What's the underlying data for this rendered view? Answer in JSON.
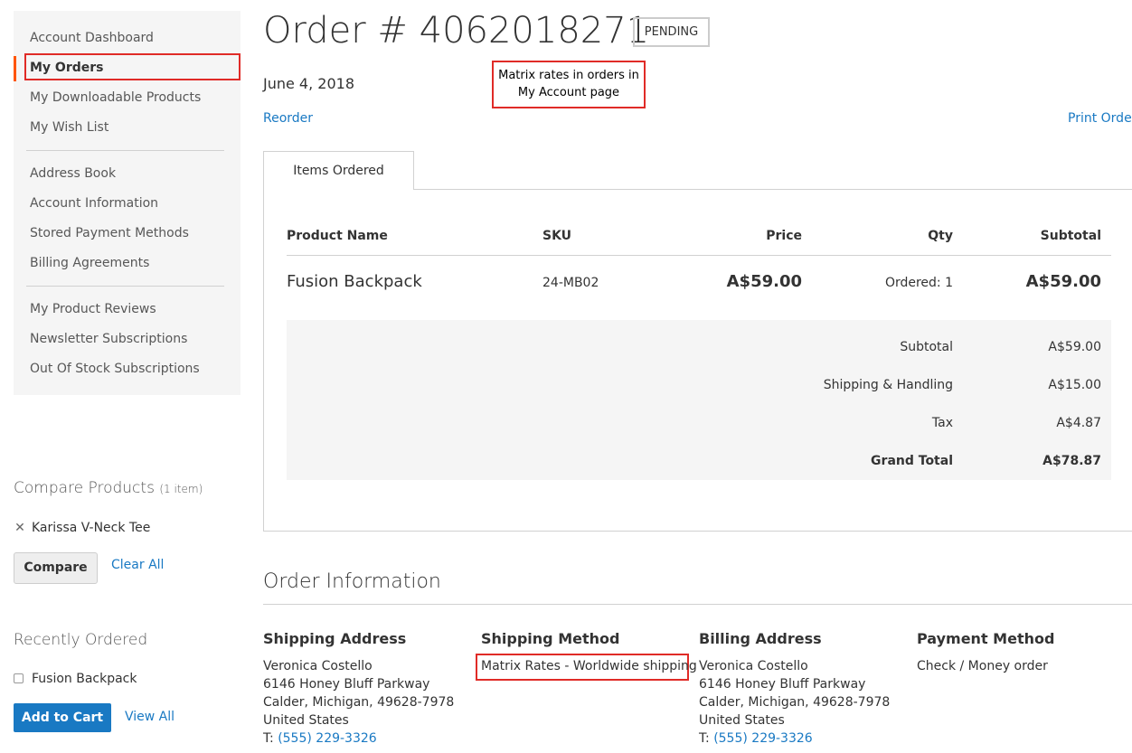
{
  "sidebar": {
    "nav": [
      {
        "label": "Account Dashboard"
      },
      {
        "label": "My Orders"
      },
      {
        "label": "My Downloadable Products"
      },
      {
        "label": "My Wish List"
      },
      {
        "label": "Address Book"
      },
      {
        "label": "Account Information"
      },
      {
        "label": "Stored Payment Methods"
      },
      {
        "label": "Billing Agreements"
      },
      {
        "label": "My Product Reviews"
      },
      {
        "label": "Newsletter Subscriptions"
      },
      {
        "label": "Out Of Stock Subscriptions"
      }
    ],
    "active_index": 1,
    "compare": {
      "title": "Compare Products",
      "count": "(1 item)",
      "item": "Karissa V-Neck Tee",
      "compare_label": "Compare",
      "clear_label": "Clear All"
    },
    "recent": {
      "title": "Recently Ordered",
      "item": "Fusion Backpack",
      "add_label": "Add to Cart",
      "view_all_label": "View All"
    }
  },
  "order": {
    "title": "Order # 4062018271",
    "status": "PENDING",
    "date": "June 4, 2018",
    "reorder_label": "Reorder",
    "print_label": "Print Order",
    "callout": "Matrix rates in orders in My Account page"
  },
  "tabs": [
    {
      "label": "Items Ordered"
    }
  ],
  "items_table": {
    "headers": {
      "name": "Product Name",
      "sku": "SKU",
      "price": "Price",
      "qty": "Qty",
      "subtotal": "Subtotal"
    },
    "rows": [
      {
        "name": "Fusion Backpack",
        "sku": "24-MB02",
        "price": "A$59.00",
        "qty": "Ordered: 1",
        "subtotal": "A$59.00"
      }
    ],
    "totals": [
      {
        "label": "Subtotal",
        "value": "A$59.00"
      },
      {
        "label": "Shipping & Handling",
        "value": "A$15.00"
      },
      {
        "label": "Tax",
        "value": "A$4.87"
      },
      {
        "label": "Grand Total",
        "value": "A$78.87"
      }
    ]
  },
  "order_info": {
    "title": "Order Information",
    "shipping_address": {
      "title": "Shipping Address",
      "lines": [
        "Veronica Costello",
        "6146 Honey Bluff Parkway",
        "Calder, Michigan, 49628-7978",
        "United States"
      ],
      "phone_prefix": "T:",
      "phone": "(555) 229-3326"
    },
    "shipping_method": {
      "title": "Shipping Method",
      "value": "Matrix Rates - Worldwide shipping"
    },
    "billing_address": {
      "title": "Billing Address",
      "lines": [
        "Veronica Costello",
        "6146 Honey Bluff Parkway",
        "Calder, Michigan, 49628-7978",
        "United States"
      ],
      "phone_prefix": "T:",
      "phone": "(555) 229-3326"
    },
    "payment_method": {
      "title": "Payment Method",
      "value": "Check / Money order"
    }
  },
  "colors": {
    "accent": "#1979c3",
    "active_marker": "#ff5501",
    "highlight": "#e02b27"
  }
}
